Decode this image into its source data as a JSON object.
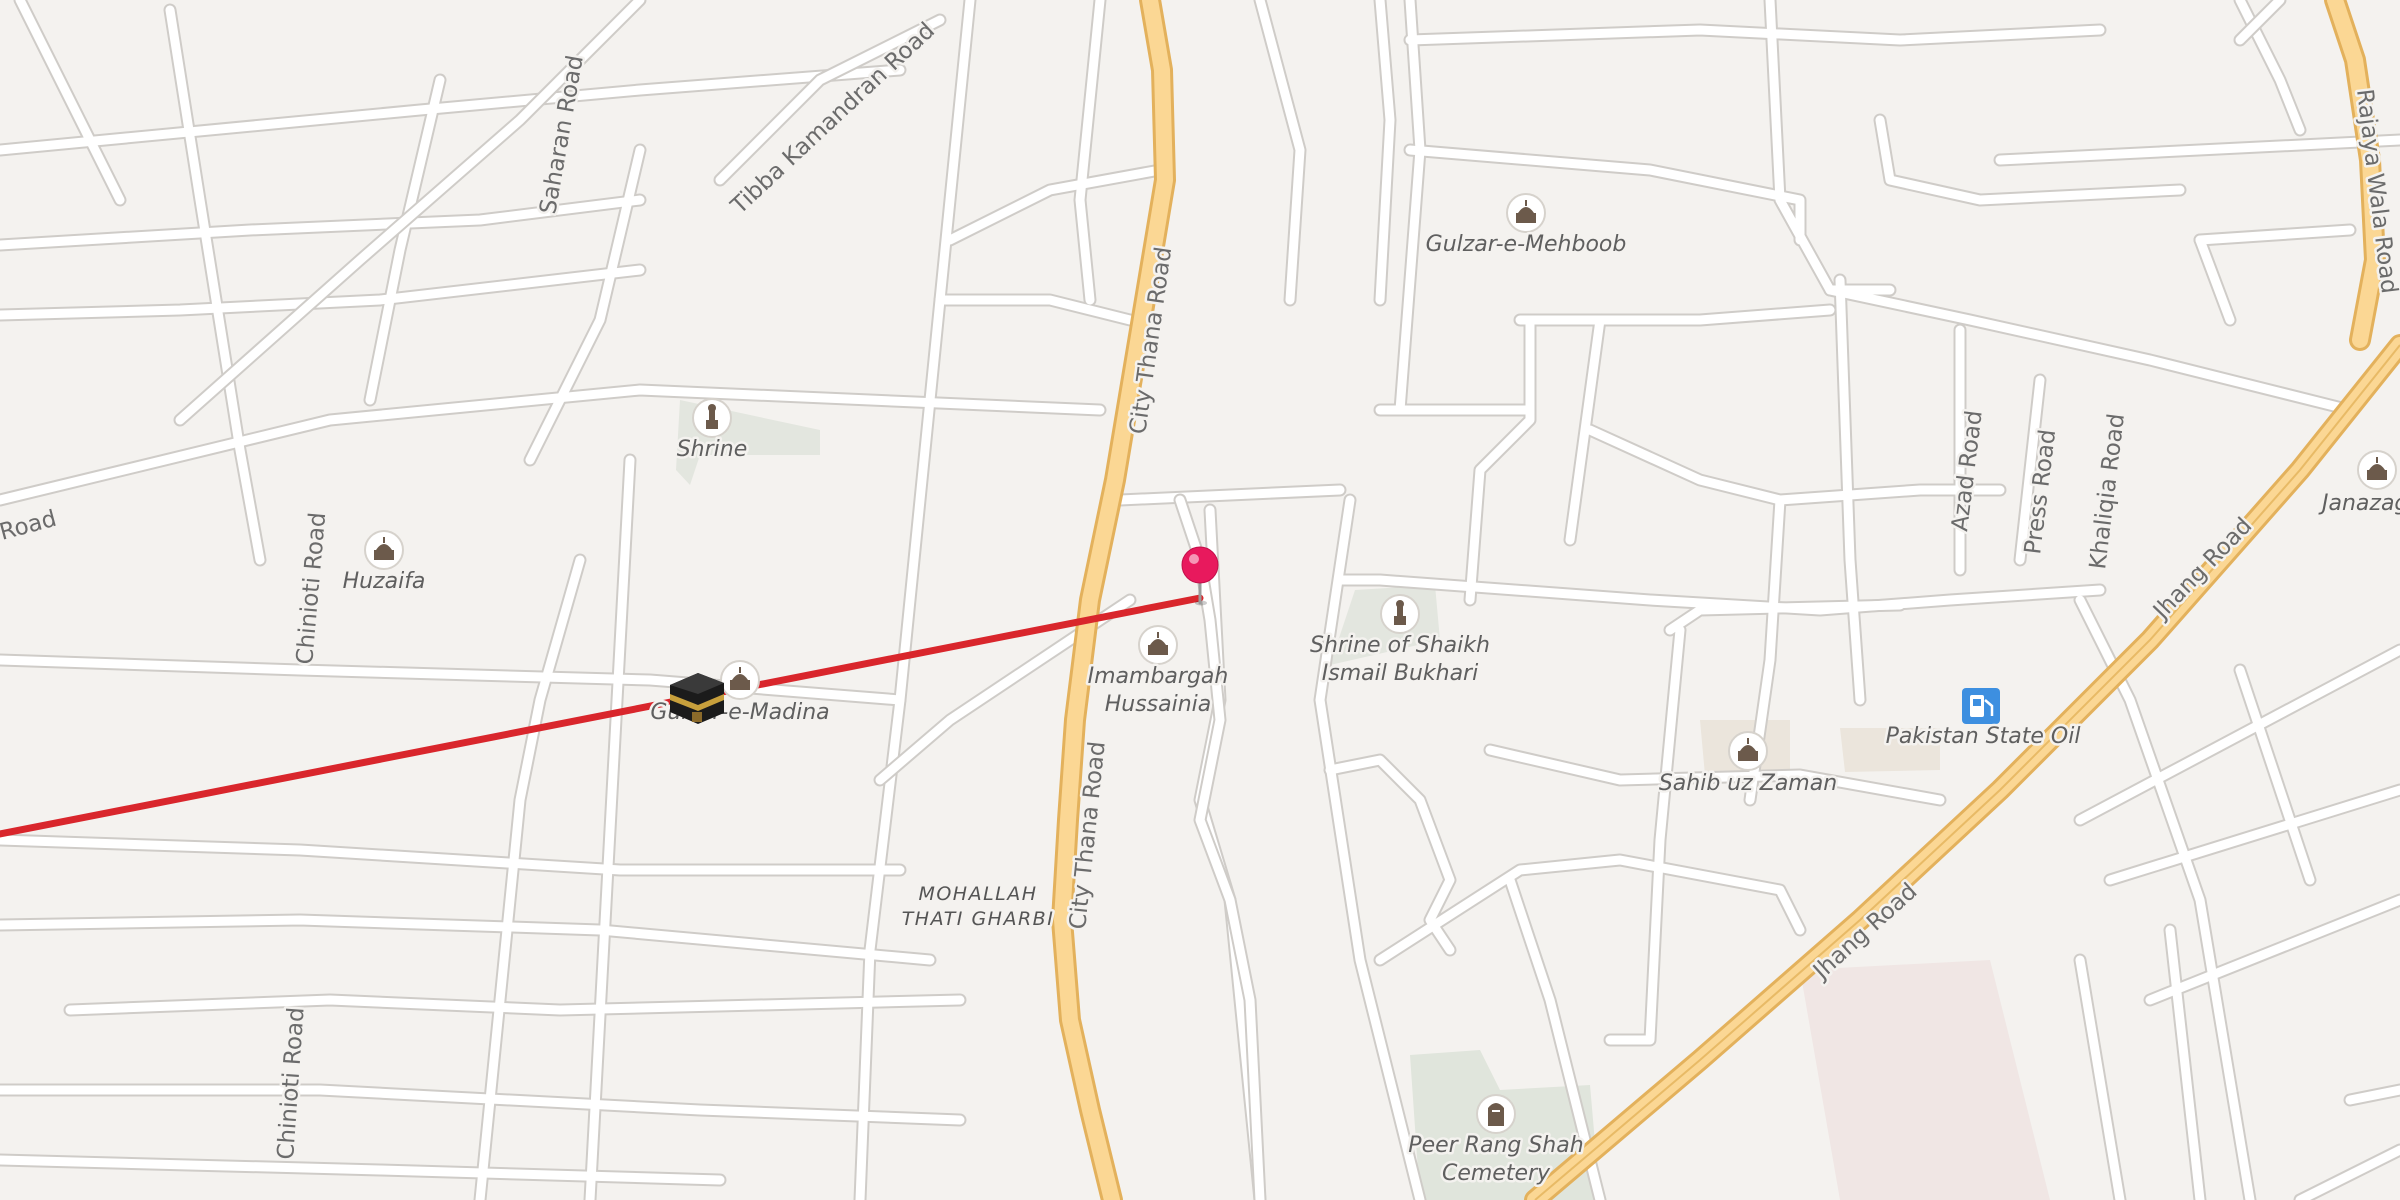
{
  "streets": {
    "saharan_road": "Saharan Road",
    "tibba_kamandran_road": "Tibba Kamandran Road",
    "city_thana_road_north": "City Thana Road",
    "city_thana_road_south": "City Thana Road",
    "chinioti_road_north": "Chinioti Road",
    "chinioti_road_south": "Chinioti Road",
    "left_road_fragment": "Road",
    "azad_road": "Azad Road",
    "press_road": "Press Road",
    "khaliqia_road": "Khaliqia Road",
    "rajaya_wala_road": "Rajaya Wala Road",
    "jhang_road_north": "Jhang Road",
    "jhang_road_south": "Jhang Road"
  },
  "pois": {
    "shrine": {
      "label": "Shrine",
      "icon": "shrine-icon"
    },
    "huzaifa": {
      "label": "Huzaifa",
      "icon": "mosque-icon"
    },
    "gulzar_e_madina": {
      "label": "Gulzar-e-Madina",
      "icon": "mosque-icon"
    },
    "gulzar_e_mehboob": {
      "label": "Gulzar-e-Mehboob",
      "icon": "mosque-icon"
    },
    "imambargah": {
      "line1": "Imambargah",
      "line2": "Hussainia",
      "icon": "mosque-icon"
    },
    "shrine_shaikh": {
      "line1": "Shrine of Shaikh",
      "line2": "Ismail Bukhari",
      "icon": "shrine-icon"
    },
    "sahib_uz_zaman": {
      "label": "Sahib uz Zaman",
      "icon": "mosque-icon"
    },
    "pakistan_state_oil": {
      "label": "Pakistan State Oil",
      "icon": "fuel-station-icon"
    },
    "peer_rang_shah": {
      "line1": "Peer Rang Shah",
      "line2": "Cemetery",
      "icon": "cemetery-icon"
    },
    "janazagah": {
      "label": "Janazag",
      "icon": "mosque-icon"
    }
  },
  "areas": {
    "mohallah_line1": "MOHALLAH",
    "mohallah_line2": "THATI GHARBI"
  },
  "markers": {
    "location_pin": {
      "icon": "location-pin-icon",
      "color": "#e8195d"
    },
    "kaaba": {
      "icon": "kaaba-icon"
    }
  },
  "qibla_line": {
    "color": "#d9262c"
  },
  "colors": {
    "background": "#f4f2ef",
    "major_road": "#fbd794",
    "minor_road": "#ffffff",
    "fuel_icon": "#3d8fe0"
  }
}
